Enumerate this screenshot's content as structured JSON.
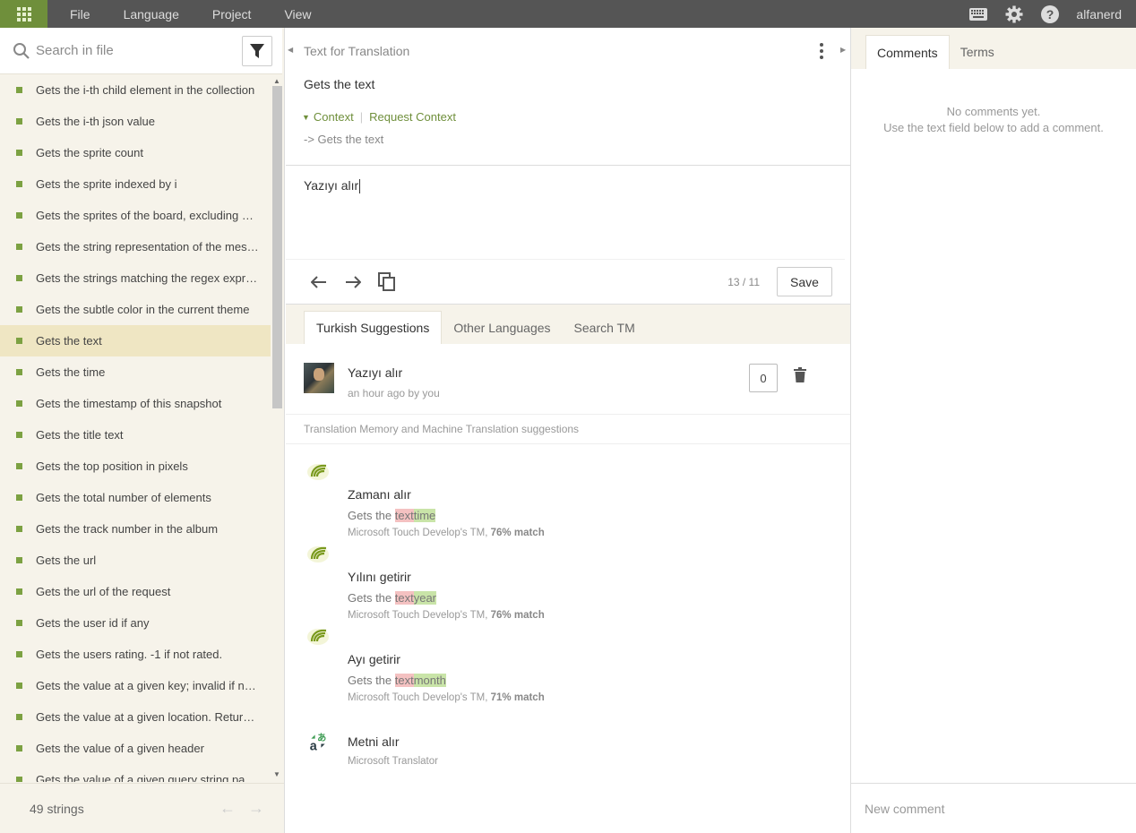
{
  "topbar": {
    "menu": [
      "File",
      "Language",
      "Project",
      "View"
    ],
    "username": "alfanerd",
    "icons": [
      "apps-grid-icon",
      "keyboard-icon",
      "gear-icon",
      "help-icon"
    ]
  },
  "left": {
    "search_placeholder": "Search in file",
    "strings": [
      "Gets the i-th child element in the collection",
      "Gets the i-th json value",
      "Gets the sprite count",
      "Gets the sprite indexed by i",
      "Gets the sprites of the board, excluding walls",
      "Gets the string representation of the message",
      "Gets the strings matching the regex expression",
      "Gets the subtle color in the current theme",
      "Gets the text",
      "Gets the time",
      "Gets the timestamp of this snapshot",
      "Gets the title text",
      "Gets the top position in pixels",
      "Gets the total number of elements",
      "Gets the track number in the album",
      "Gets the url",
      "Gets the url of the request",
      "Gets the user id if any",
      "Gets the users rating. -1 if not rated.",
      "Gets the value at a given key; invalid if not found",
      "Gets the value at a given location. Returns invalid",
      "Gets the value of a given header",
      "Gets the value of a given query string parameter"
    ],
    "active_index": 8,
    "count_label": "49 strings"
  },
  "center": {
    "source_title": "Text for Translation",
    "source_text": "Gets the text",
    "context_label": "Context",
    "request_context_label": "Request Context",
    "context_text": "-> Gets the text",
    "translation": "Yazıyı alır",
    "counter": "13 / 11",
    "save_label": "Save",
    "tabs": [
      "Turkish Suggestions",
      "Other Languages",
      "Search TM"
    ],
    "user_suggestion": {
      "text": "Yazıyı alır",
      "meta": "an hour ago by you",
      "votes": "0"
    },
    "tm_header": "Translation Memory and Machine Translation suggestions",
    "tm": [
      {
        "text": "Zamanı alır",
        "src_prefix": "Gets the ",
        "src_del": "text",
        "src_ins": "time",
        "origin": "Microsoft Touch Develop's TM, ",
        "match": "76% match"
      },
      {
        "text": "Yılını getirir",
        "src_prefix": "Gets the ",
        "src_del": "text",
        "src_ins": "year",
        "origin": "Microsoft Touch Develop's TM, ",
        "match": "76% match"
      },
      {
        "text": "Ayı getirir",
        "src_prefix": "Gets the ",
        "src_del": "text",
        "src_ins": "month",
        "origin": "Microsoft Touch Develop's TM, ",
        "match": "71% match"
      }
    ],
    "mt": {
      "text": "Metni alır",
      "origin": "Microsoft Translator"
    }
  },
  "right": {
    "tabs": [
      "Comments",
      "Terms"
    ],
    "no_comments_line1": "No comments yet.",
    "no_comments_line2": "Use the text field below to add a comment.",
    "new_comment_placeholder": "New comment"
  },
  "colors": {
    "topbar": "#555555",
    "accent_green": "#6f8f3b",
    "status_dot": "#7ca142",
    "active_row": "#efe6c3",
    "panel_bg": "#f6f3ea",
    "diff_delete": "#f4c1c1",
    "diff_insert": "#c9e4a8"
  }
}
